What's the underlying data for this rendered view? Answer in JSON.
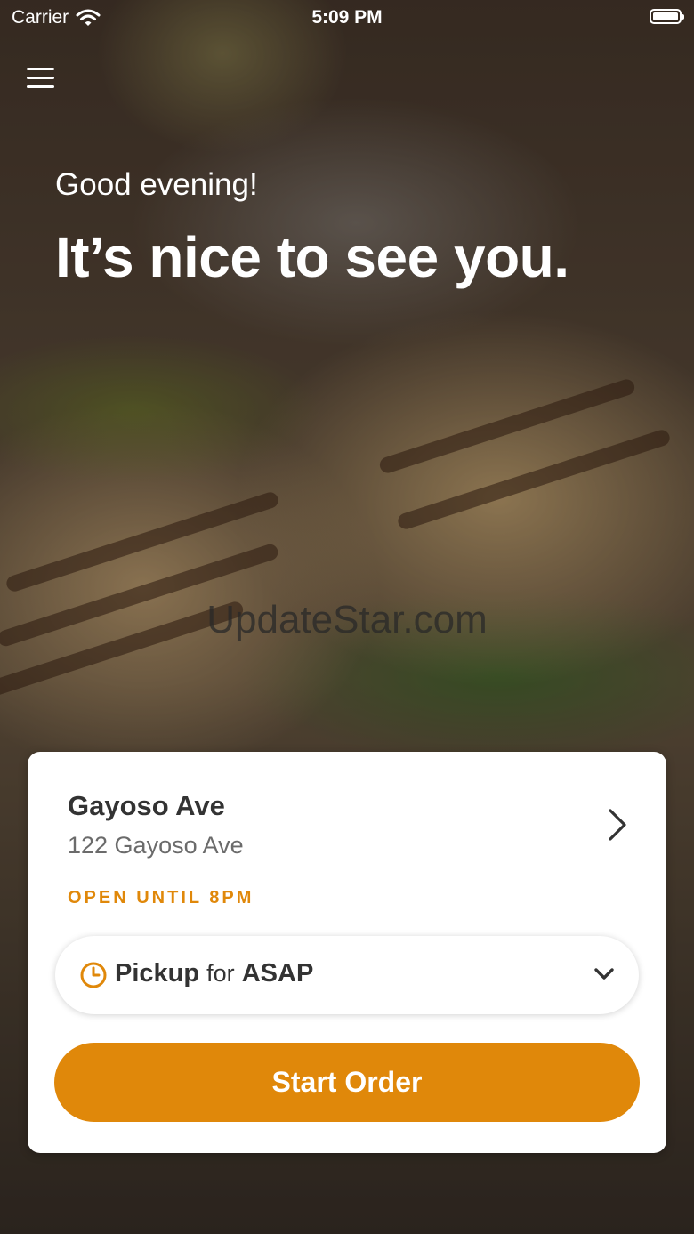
{
  "status_bar": {
    "carrier": "Carrier",
    "time": "5:09 PM",
    "icons": [
      "wifi-icon",
      "battery-icon"
    ]
  },
  "header": {
    "menu_icon": "hamburger-menu-icon"
  },
  "greeting": {
    "salutation": "Good evening!",
    "headline": "It’s nice to see you."
  },
  "watermark": "UpdateStar.com",
  "location_card": {
    "name": "Gayoso Ave",
    "address": "122 Gayoso Ave",
    "hours": "OPEN UNTIL 8PM",
    "order_type": {
      "mode": "Pickup",
      "connector": "for",
      "time": "ASAP",
      "icon": "clock-icon"
    },
    "start_order_label": "Start Order"
  },
  "colors": {
    "accent": "#e0880a",
    "card_background": "#ffffff",
    "title_text": "#333333",
    "secondary_text": "#6b6b6b"
  }
}
